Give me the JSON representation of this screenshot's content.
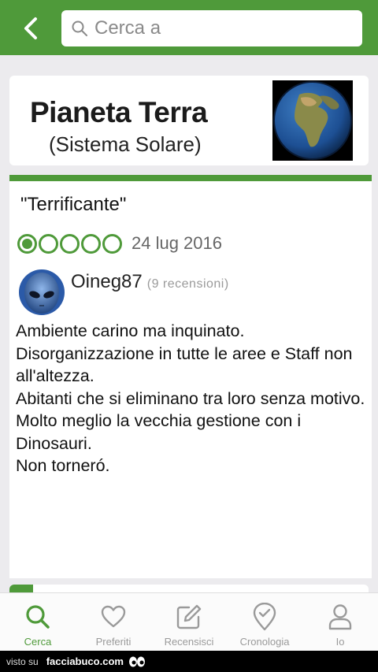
{
  "header": {
    "back_icon": "chevron-left-icon",
    "search_icon": "search-icon",
    "search_placeholder": "Cerca a"
  },
  "place": {
    "name": "Pianeta Terra",
    "subtitle": "(Sistema Solare)",
    "image": "earth-globe-photo"
  },
  "review": {
    "title": "\"Terrificante\"",
    "rating": 1,
    "rating_max": 5,
    "date": "24 lug 2016",
    "username": "Oineg87",
    "review_count": "(9 recensioni)",
    "body": [
      "Ambiente carino ma inquinato.",
      "Disorganizzazione in tutte le aree e Staff non all'altezza.",
      "Abitanti che si eliminano tra loro senza motivo.",
      "Molto meglio la vecchia gestione con i Dinosauri.",
      "Non torneró."
    ]
  },
  "tabs": [
    {
      "label": "Cerca",
      "icon": "search-icon",
      "active": true
    },
    {
      "label": "Preferiti",
      "icon": "heart-icon",
      "active": false
    },
    {
      "label": "Recensisci",
      "icon": "edit-icon",
      "active": false
    },
    {
      "label": "Cronologia",
      "icon": "location-check-icon",
      "active": false
    },
    {
      "label": "Io",
      "icon": "user-icon",
      "active": false
    }
  ],
  "footer": {
    "visto_su": "visto su",
    "site": "facciabuco.com"
  },
  "colors": {
    "brand_green": "#4f9a3a",
    "inactive_grey": "#9a9a9a"
  }
}
